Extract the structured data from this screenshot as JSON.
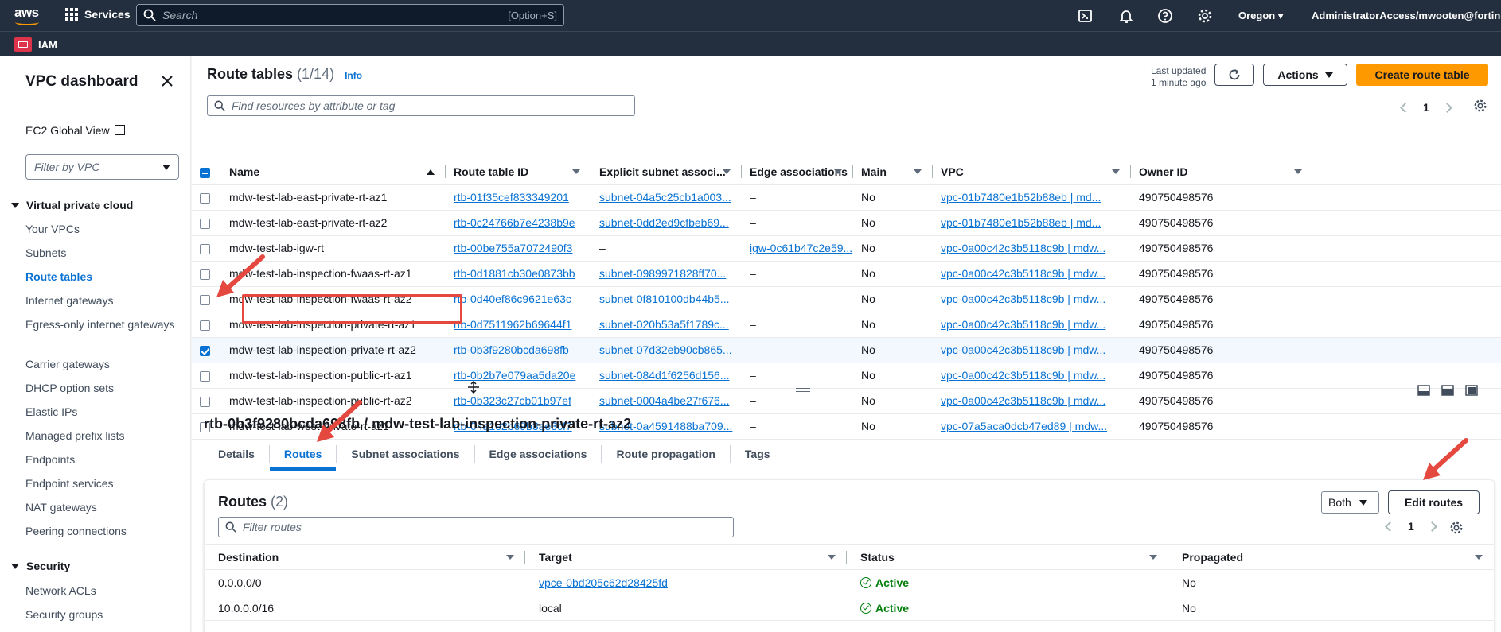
{
  "topnav": {
    "logo_text": "aws",
    "services_label": "Services",
    "search_placeholder": "Search",
    "search_shortcut": "[Option+S]",
    "region": "Oregon",
    "account": "AdministratorAccess/mwooten@fortinet.co",
    "icons": [
      "cloudshell-icon",
      "bell-icon",
      "help-icon",
      "gear-icon"
    ]
  },
  "subnav": {
    "service_badge": "IAM"
  },
  "sidebar": {
    "title": "VPC dashboard",
    "ec2_global_view": "EC2 Global View",
    "filter_placeholder": "Filter by VPC",
    "sections": [
      {
        "label": "Virtual private cloud",
        "items": [
          {
            "label": "Your VPCs"
          },
          {
            "label": "Subnets"
          },
          {
            "label": "Route tables",
            "active": true
          },
          {
            "label": "Internet gateways"
          },
          {
            "label": "Egress-only internet gateways"
          },
          {
            "label": "Carrier gateways"
          },
          {
            "label": "DHCP option sets"
          },
          {
            "label": "Elastic IPs"
          },
          {
            "label": "Managed prefix lists"
          },
          {
            "label": "Endpoints"
          },
          {
            "label": "Endpoint services"
          },
          {
            "label": "NAT gateways"
          },
          {
            "label": "Peering connections"
          }
        ]
      },
      {
        "label": "Security",
        "items": [
          {
            "label": "Network ACLs"
          },
          {
            "label": "Security groups"
          }
        ]
      }
    ]
  },
  "route_tables": {
    "title": "Route tables",
    "count": "(1/14)",
    "info": "Info",
    "last_updated_line1": "Last updated",
    "last_updated_line2": "1 minute ago",
    "actions_label": "Actions",
    "create_label": "Create route table",
    "filter_placeholder": "Find resources by attribute or tag",
    "page": "1",
    "columns": [
      "Name",
      "Route table ID",
      "Explicit subnet associ...",
      "Edge associations",
      "Main",
      "VPC",
      "Owner ID"
    ],
    "rows": [
      {
        "name": "mdw-test-lab-east-private-rt-az1",
        "id": "rtb-01f35cef833349201",
        "subnet": "subnet-04a5c25cb1a003...",
        "edge": "–",
        "main": "No",
        "vpc": "vpc-01b7480e1b52b88eb | md...",
        "owner": "490750498576",
        "checked": false
      },
      {
        "name": "mdw-test-lab-east-private-rt-az2",
        "id": "rtb-0c24766b7e4238b9e",
        "subnet": "subnet-0dd2ed9cfbeb69...",
        "edge": "–",
        "main": "No",
        "vpc": "vpc-01b7480e1b52b88eb | md...",
        "owner": "490750498576",
        "checked": false
      },
      {
        "name": "mdw-test-lab-igw-rt",
        "id": "rtb-00be755a7072490f3",
        "subnet": "–",
        "edge": "igw-0c61b47c2e59...",
        "main": "No",
        "vpc": "vpc-0a00c42c3b5118c9b | mdw...",
        "owner": "490750498576",
        "checked": false
      },
      {
        "name": "mdw-test-lab-inspection-fwaas-rt-az1",
        "id": "rtb-0d1881cb30e0873bb",
        "subnet": "subnet-0989971828ff70...",
        "edge": "–",
        "main": "No",
        "vpc": "vpc-0a00c42c3b5118c9b | mdw...",
        "owner": "490750498576",
        "checked": false
      },
      {
        "name": "mdw-test-lab-inspection-fwaas-rt-az2",
        "id": "rtb-0d40ef86c9621e63c",
        "subnet": "subnet-0f810100db44b5...",
        "edge": "–",
        "main": "No",
        "vpc": "vpc-0a00c42c3b5118c9b | mdw...",
        "owner": "490750498576",
        "checked": false
      },
      {
        "name": "mdw-test-lab-inspection-private-rt-az1",
        "id": "rtb-0d7511962b69644f1",
        "subnet": "subnet-020b53a5f1789c...",
        "edge": "–",
        "main": "No",
        "vpc": "vpc-0a00c42c3b5118c9b | mdw...",
        "owner": "490750498576",
        "checked": false
      },
      {
        "name": "mdw-test-lab-inspection-private-rt-az2",
        "id": "rtb-0b3f9280bcda698fb",
        "subnet": "subnet-07d32eb90cb865...",
        "edge": "–",
        "main": "No",
        "vpc": "vpc-0a00c42c3b5118c9b | mdw...",
        "owner": "490750498576",
        "checked": true
      },
      {
        "name": "mdw-test-lab-inspection-public-rt-az1",
        "id": "rtb-0b2b7e079aa5da20e",
        "subnet": "subnet-084d1f6256d156...",
        "edge": "–",
        "main": "No",
        "vpc": "vpc-0a00c42c3b5118c9b | mdw...",
        "owner": "490750498576",
        "checked": false
      },
      {
        "name": "mdw-test-lab-inspection-public-rt-az2",
        "id": "rtb-0b323c27cb01b97ef",
        "subnet": "subnet-0004a4be27f676...",
        "edge": "–",
        "main": "No",
        "vpc": "vpc-0a00c42c3b5118c9b | mdw...",
        "owner": "490750498576",
        "checked": false
      },
      {
        "name": "mdw-test-lab-west-private-rt-az1",
        "id": "rtb-04a1e2b69b3ae3cf7",
        "subnet": "subnet-0a4591488ba709...",
        "edge": "–",
        "main": "No",
        "vpc": "vpc-07a5aca0dcb47ed89 | mdw...",
        "owner": "490750498576",
        "checked": false
      }
    ]
  },
  "detail": {
    "title": "rtb-0b3f9280bcda698fb / mdw-test-lab-inspection-private-rt-az2",
    "tabs": [
      "Details",
      "Routes",
      "Subnet associations",
      "Edge associations",
      "Route propagation",
      "Tags"
    ],
    "active_tab": "Routes",
    "routes": {
      "title": "Routes",
      "count": "(2)",
      "filter_placeholder": "Filter routes",
      "both_label": "Both",
      "edit_label": "Edit routes",
      "page": "1",
      "columns": [
        "Destination",
        "Target",
        "Status",
        "Propagated"
      ],
      "rows": [
        {
          "destination": "0.0.0.0/0",
          "target": "vpce-0bd205c62d28425fd",
          "target_link": true,
          "status": "Active",
          "propagated": "No"
        },
        {
          "destination": "10.0.0.0/16",
          "target": "local",
          "target_link": false,
          "status": "Active",
          "propagated": "No"
        }
      ]
    }
  },
  "colors": {
    "nav_bg": "#232f3e",
    "link": "#0972d3",
    "primary_button": "#ff9900",
    "active_status": "#037f0c",
    "annotation": "#e5483f"
  }
}
